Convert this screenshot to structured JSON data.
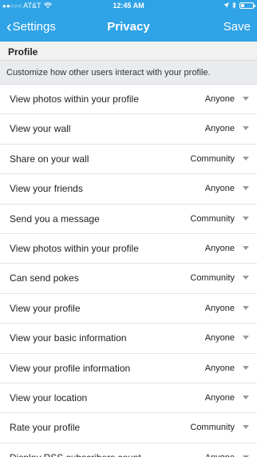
{
  "status_bar": {
    "signal": "●●○○○",
    "carrier": "AT&T",
    "wifi_icon": "wifi-icon",
    "time": "12:45 AM",
    "location_icon": "location-arrow-icon",
    "bluetooth_icon": "bluetooth-icon",
    "battery_level": 0.3
  },
  "nav": {
    "back_label": "Settings",
    "title": "Privacy",
    "save_label": "Save"
  },
  "section": {
    "title": "Profile",
    "description": "Customize how other users interact with your profile."
  },
  "rows": [
    {
      "label": "View photos within your profile",
      "value": "Anyone"
    },
    {
      "label": "View your wall",
      "value": "Anyone"
    },
    {
      "label": "Share on your wall",
      "value": "Community"
    },
    {
      "label": "View your friends",
      "value": "Anyone"
    },
    {
      "label": "Send you a message",
      "value": "Community"
    },
    {
      "label": "View photos within your profile",
      "value": "Anyone"
    },
    {
      "label": "Can send pokes",
      "value": "Community"
    },
    {
      "label": "View your profile",
      "value": "Anyone"
    },
    {
      "label": "View your basic information",
      "value": "Anyone"
    },
    {
      "label": "View your profile information",
      "value": "Anyone"
    },
    {
      "label": "View your location",
      "value": "Anyone"
    },
    {
      "label": "Rate your profile",
      "value": "Community"
    },
    {
      "label": "Display RSS subscribers count",
      "value": "Anyone"
    }
  ],
  "colors": {
    "accent": "#2fa3e6"
  }
}
